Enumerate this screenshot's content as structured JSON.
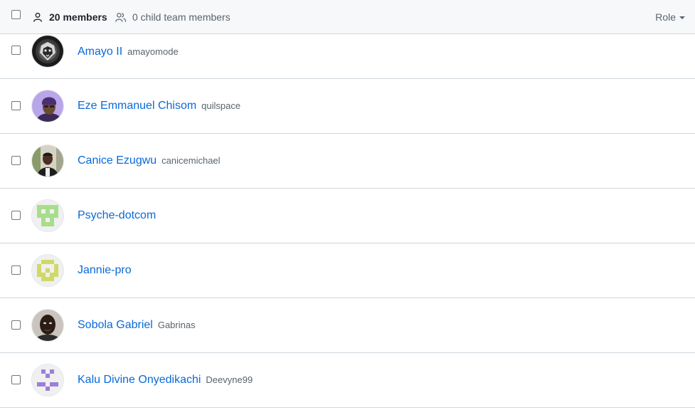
{
  "header": {
    "member_count_label": "20 members",
    "child_team_label": "0 child team members",
    "role_filter_label": "Role"
  },
  "colors": {
    "link": "#0969da",
    "muted": "#59636e",
    "border": "#d0d7de",
    "header_bg": "#f6f8fa"
  },
  "members": [
    {
      "name": "Amayo II",
      "login": "amayomode",
      "avatar": "lion-portrait"
    },
    {
      "name": "Eze Emmanuel Chisom",
      "login": "quilspace",
      "avatar": "photo-purple-background"
    },
    {
      "name": "Canice Ezugwu",
      "login": "canicemichael",
      "avatar": "photo-outdoor"
    },
    {
      "name": "Psyche-dotcom",
      "login": "",
      "avatar": "identicon-green"
    },
    {
      "name": "Jannie-pro",
      "login": "",
      "avatar": "identicon-yellow-green"
    },
    {
      "name": "Sobola Gabriel",
      "login": "Gabrinas",
      "avatar": "photo-portrait"
    },
    {
      "name": "Kalu Divine Onyedikachi",
      "login": "Deevyne99",
      "avatar": "identicon-purple"
    }
  ]
}
